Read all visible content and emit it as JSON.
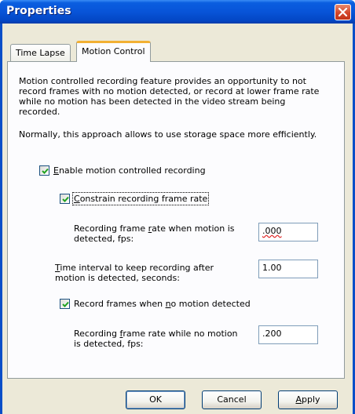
{
  "window": {
    "title": "Properties"
  },
  "tabs": [
    {
      "label": "Time Lapse",
      "active": false
    },
    {
      "label": "Motion Control",
      "active": true
    }
  ],
  "panel": {
    "description_lines": [
      "Motion controlled recording feature provides an opportunity to not",
      "record frames with no motion detected, or record at lower frame rate",
      "while no motion has been detected in the video stream being",
      "recorded."
    ],
    "note": "Normally, this approach allows to use storage space more efficiently.",
    "enable_motion": {
      "pre": "",
      "mnemonic": "E",
      "post": "nable motion controlled recording",
      "checked": true
    },
    "constrain_rate": {
      "pre": "",
      "mnemonic": "C",
      "post": "onstrain recording frame rate",
      "checked": true
    },
    "rate_motion": {
      "line1_pre": "Recording frame ",
      "line1_mnemonic": "r",
      "line1_post": "ate when motion is",
      "line2": "detected, fps:",
      "value": ".000"
    },
    "interval": {
      "line1_pre": "",
      "line1_mnemonic": "T",
      "line1_post": "ime interval to keep recording after",
      "line2": "motion is detected, seconds:",
      "value": "1.00"
    },
    "record_no_motion": {
      "pre": "Record frames when ",
      "mnemonic": "n",
      "post": "o motion detected",
      "checked": true
    },
    "rate_no_motion": {
      "line1_pre": "Recording ",
      "line1_mnemonic": "f",
      "line1_post": "rame rate while no motion",
      "line2": "is detected, fps:",
      "value": ".200"
    }
  },
  "buttons": {
    "ok": "OK",
    "cancel": "Cancel",
    "apply_mnemonic": "A",
    "apply_rest": "pply"
  },
  "colors": {
    "titlebar": "#0854d8",
    "face": "#ece9d8",
    "panel": "#fcfcfe",
    "tab_highlight": "#f2b033",
    "close": "#d3462a"
  },
  "icons": {
    "close": "close-icon",
    "check": "checkmark-icon"
  }
}
